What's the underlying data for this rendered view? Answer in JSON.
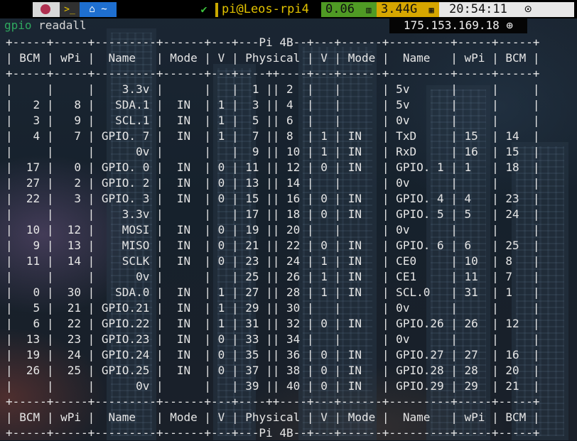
{
  "statusbar": {
    "pi_icon": "raspberry-pi-icon",
    "term_icon": "terminal-icon",
    "term_glyph": ">_",
    "home_icon": "home-icon",
    "home_glyph": "⌂ ~",
    "check": "✔",
    "user_host": "pi@Leos-rpi4",
    "load": "0.06",
    "load_icon": "bar-chart-icon",
    "memory": "3.44G",
    "memory_icon": "chip-icon",
    "time": "20:54:11",
    "clock_icon": "clock-icon"
  },
  "prompt": {
    "command": "gpio",
    "argument": "readall"
  },
  "network": {
    "ip": "175.153.169.18",
    "globe_icon": "globe-icon"
  },
  "table": {
    "board_label": "Pi 4B",
    "separator": "+-----+-----+---------+------+---+---Pi 4B--+---+------+---------+-----+-----+",
    "separator_plain": "+-----+-----+---------+------+---+----++----+---+------+---------+-----+-----+",
    "header": {
      "bcm": "BCM",
      "wpi": "wPi",
      "name": "Name",
      "mode": "Mode",
      "v": "V",
      "physical": "Physical",
      "v2": "V",
      "mode2": "Mode",
      "name2": "Name",
      "wpi2": "wPi",
      "bcm2": "BCM"
    },
    "rows": [
      [
        "",
        "",
        "3.3v",
        "",
        "",
        "1",
        "2",
        "",
        "",
        "5v",
        "",
        ""
      ],
      [
        "2",
        "8",
        "SDA.1",
        "IN",
        "1",
        "3",
        "4",
        "",
        "",
        "5v",
        "",
        ""
      ],
      [
        "3",
        "9",
        "SCL.1",
        "IN",
        "1",
        "5",
        "6",
        "",
        "",
        "0v",
        "",
        ""
      ],
      [
        "4",
        "7",
        "GPIO. 7",
        "IN",
        "1",
        "7",
        "8",
        "1",
        "IN",
        "TxD",
        "15",
        "14"
      ],
      [
        "",
        "",
        "0v",
        "",
        "",
        "9",
        "10",
        "1",
        "IN",
        "RxD",
        "16",
        "15"
      ],
      [
        "17",
        "0",
        "GPIO. 0",
        "IN",
        "0",
        "11",
        "12",
        "0",
        "IN",
        "GPIO. 1",
        "1",
        "18"
      ],
      [
        "27",
        "2",
        "GPIO. 2",
        "IN",
        "0",
        "13",
        "14",
        "",
        "",
        "0v",
        "",
        ""
      ],
      [
        "22",
        "3",
        "GPIO. 3",
        "IN",
        "0",
        "15",
        "16",
        "0",
        "IN",
        "GPIO. 4",
        "4",
        "23"
      ],
      [
        "",
        "",
        "3.3v",
        "",
        "",
        "17",
        "18",
        "0",
        "IN",
        "GPIO. 5",
        "5",
        "24"
      ],
      [
        "10",
        "12",
        "MOSI",
        "IN",
        "0",
        "19",
        "20",
        "",
        "",
        "0v",
        "",
        ""
      ],
      [
        "9",
        "13",
        "MISO",
        "IN",
        "0",
        "21",
        "22",
        "0",
        "IN",
        "GPIO. 6",
        "6",
        "25"
      ],
      [
        "11",
        "14",
        "SCLK",
        "IN",
        "0",
        "23",
        "24",
        "1",
        "IN",
        "CE0",
        "10",
        "8"
      ],
      [
        "",
        "",
        "0v",
        "",
        "",
        "25",
        "26",
        "1",
        "IN",
        "CE1",
        "11",
        "7"
      ],
      [
        "0",
        "30",
        "SDA.0",
        "IN",
        "1",
        "27",
        "28",
        "1",
        "IN",
        "SCL.0",
        "31",
        "1"
      ],
      [
        "5",
        "21",
        "GPIO.21",
        "IN",
        "1",
        "29",
        "30",
        "",
        "",
        "0v",
        "",
        ""
      ],
      [
        "6",
        "22",
        "GPIO.22",
        "IN",
        "1",
        "31",
        "32",
        "0",
        "IN",
        "GPIO.26",
        "26",
        "12"
      ],
      [
        "13",
        "23",
        "GPIO.23",
        "IN",
        "0",
        "33",
        "34",
        "",
        "",
        "0v",
        "",
        ""
      ],
      [
        "19",
        "24",
        "GPIO.24",
        "IN",
        "0",
        "35",
        "36",
        "0",
        "IN",
        "GPIO.27",
        "27",
        "16"
      ],
      [
        "26",
        "25",
        "GPIO.25",
        "IN",
        "0",
        "37",
        "38",
        "0",
        "IN",
        "GPIO.28",
        "28",
        "20"
      ],
      [
        "",
        "",
        "0v",
        "",
        "",
        "39",
        "40",
        "0",
        "IN",
        "GPIO.29",
        "29",
        "21"
      ]
    ]
  }
}
